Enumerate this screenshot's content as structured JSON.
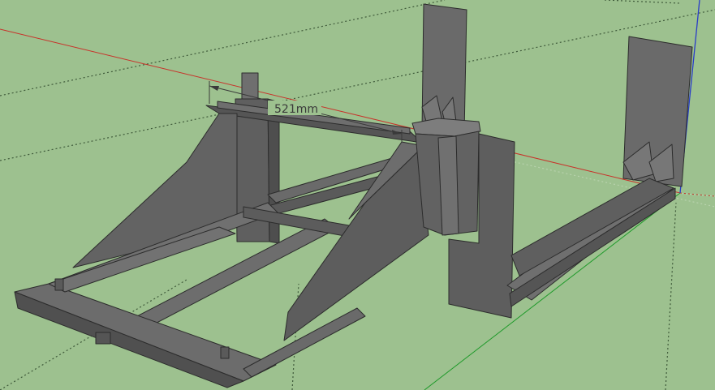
{
  "viewport": {
    "background": "#9dc18f",
    "colors": {
      "face_dark": "#5a5a5a",
      "face_mid": "#6b6b6b",
      "face_light": "#7a7a7a",
      "edge": "#2c2c2c",
      "axis_red": "#c8322a",
      "axis_green": "#1e9a2a",
      "axis_blue": "#2a3cc8",
      "dotted": "#3f5a3a",
      "dotted_light": "#b8d2ad"
    }
  },
  "dimension": {
    "label": "521mm"
  }
}
